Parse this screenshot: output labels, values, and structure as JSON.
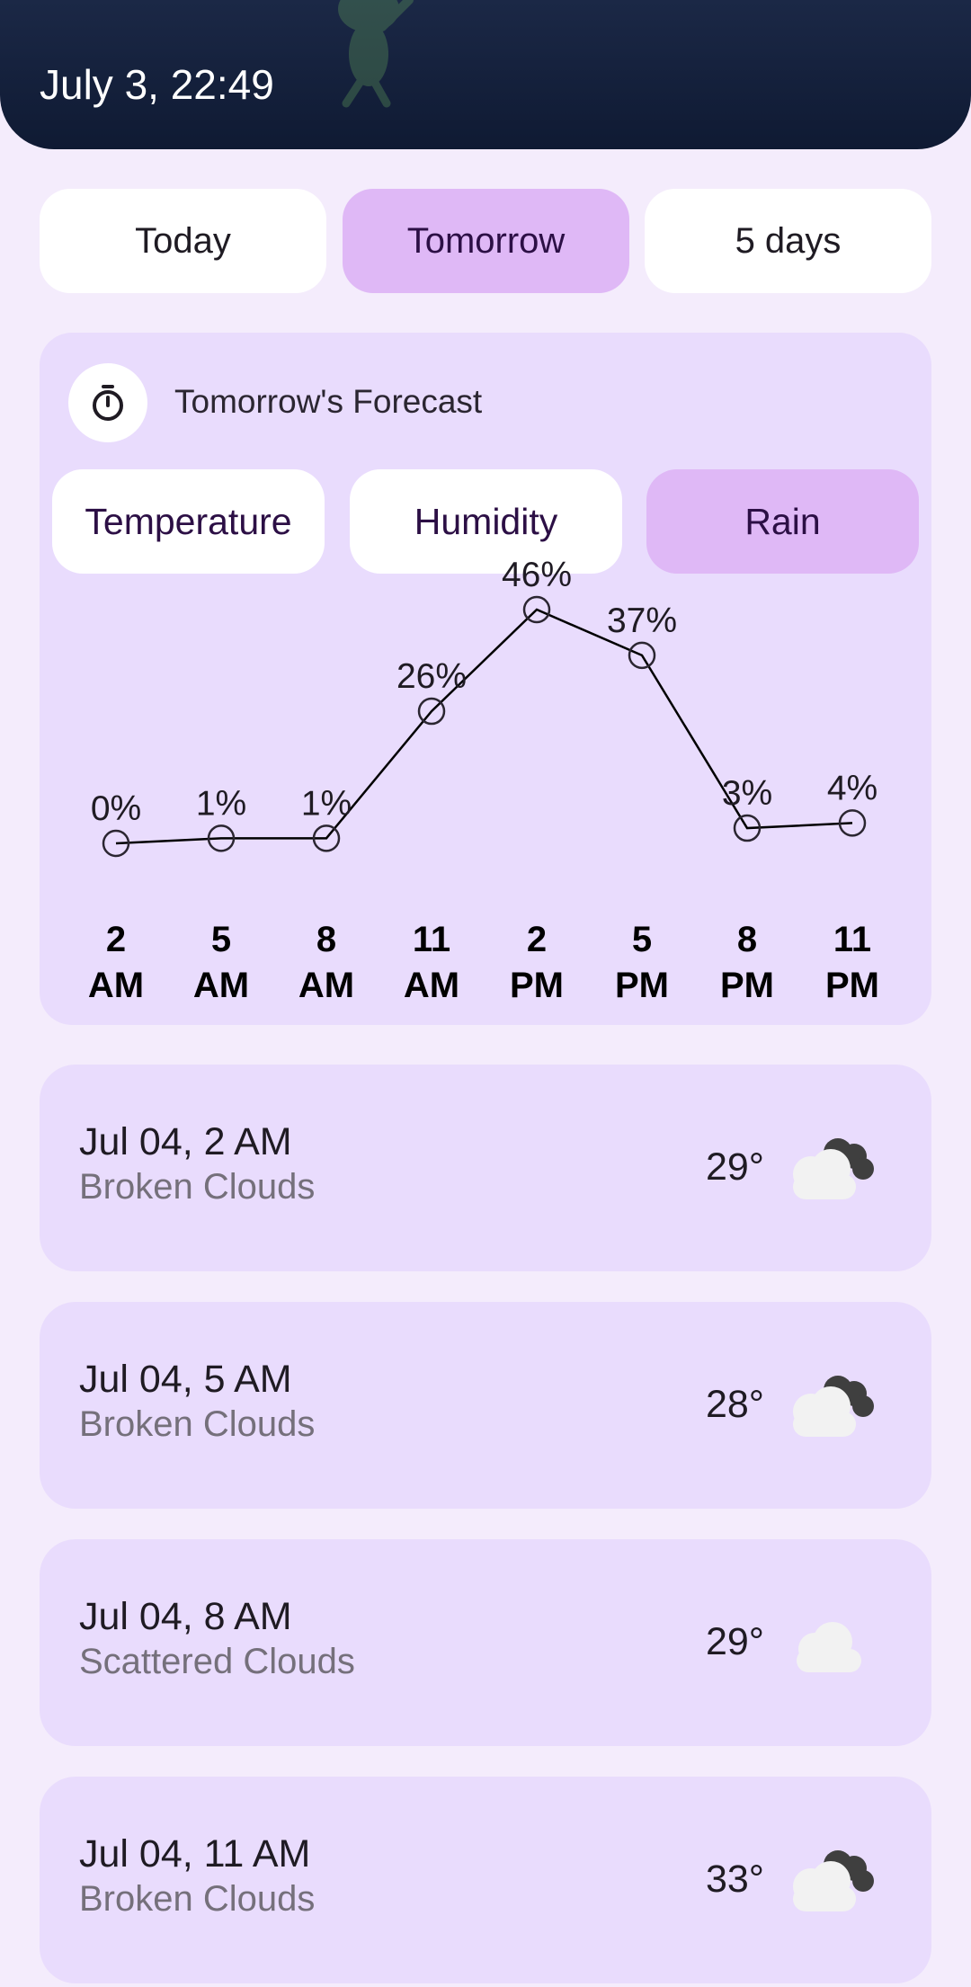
{
  "header": {
    "datetime": "July 3, 22:49"
  },
  "day_tabs": [
    {
      "label": "Today",
      "active": false
    },
    {
      "label": "Tomorrow",
      "active": true
    },
    {
      "label": "5 days",
      "active": false
    }
  ],
  "forecast": {
    "icon": "timer-icon",
    "title": "Tomorrow's Forecast",
    "metric_tabs": [
      {
        "label": "Temperature",
        "active": false
      },
      {
        "label": "Humidity",
        "active": false
      },
      {
        "label": "Rain",
        "active": true
      }
    ]
  },
  "chart_data": {
    "type": "line",
    "title": "",
    "x": [
      "2 AM",
      "5 AM",
      "8 AM",
      "11 AM",
      "2 PM",
      "5 PM",
      "8 PM",
      "11 PM"
    ],
    "x_line1": [
      "2",
      "5",
      "8",
      "11",
      "2",
      "5",
      "8",
      "11"
    ],
    "x_line2": [
      "AM",
      "AM",
      "AM",
      "AM",
      "PM",
      "PM",
      "PM",
      "PM"
    ],
    "values": [
      0,
      1,
      1,
      26,
      46,
      37,
      3,
      4
    ],
    "labels": [
      "0%",
      "1%",
      "1%",
      "26%",
      "46%",
      "37%",
      "3%",
      "4%"
    ],
    "unit": "%",
    "ylim": [
      0,
      46
    ],
    "grid": false,
    "line_color": "#000000"
  },
  "hourly": [
    {
      "time": "Jul 04, 2 AM",
      "condition": "Broken Clouds",
      "temp": "29°",
      "icon": "broken-clouds-icon"
    },
    {
      "time": "Jul 04, 5 AM",
      "condition": "Broken Clouds",
      "temp": "28°",
      "icon": "broken-clouds-icon"
    },
    {
      "time": "Jul 04, 8 AM",
      "condition": "Scattered Clouds",
      "temp": "29°",
      "icon": "scattered-clouds-icon"
    },
    {
      "time": "Jul 04, 11 AM",
      "condition": "Broken Clouds",
      "temp": "33°",
      "icon": "broken-clouds-icon"
    }
  ],
  "colors": {
    "background": "#f4ecfc",
    "header": "#0f1a33",
    "card": "#e9dcfd",
    "active_tab": "#dfb8f6"
  }
}
